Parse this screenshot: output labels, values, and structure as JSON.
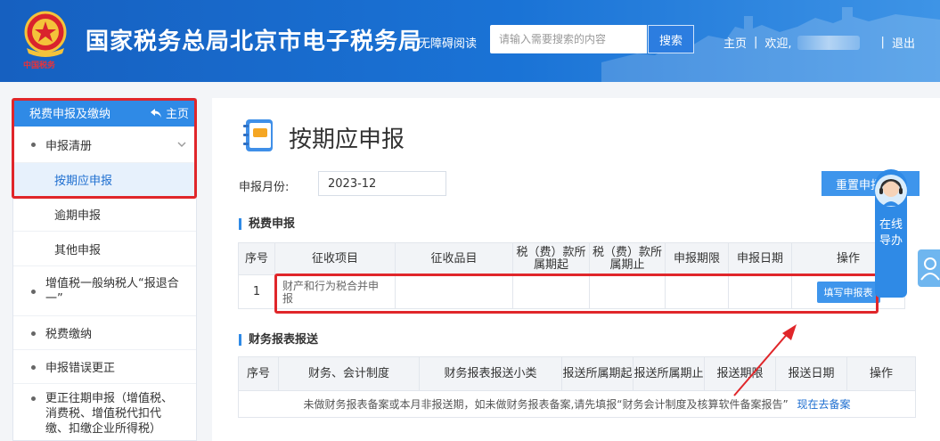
{
  "header": {
    "site_title": "国家税务总局北京市电子税务局",
    "emblem_caption": "中国税务",
    "accessibility": "无障碍阅读",
    "search_placeholder": "请输入需要搜索的内容",
    "search_button": "搜索",
    "nav_home": "主页",
    "sep": "|",
    "welcome": "欢迎,",
    "logout": "退出"
  },
  "sidebar": {
    "title": "税费申报及缴纳",
    "home": "主页",
    "items": [
      {
        "label": "申报清册"
      },
      {
        "label": "按期应申报"
      },
      {
        "label": "逾期申报"
      },
      {
        "label": "其他申报"
      },
      {
        "label": "增值税一般纳税人“报退合一”"
      },
      {
        "label": "税费缴纳"
      },
      {
        "label": "申报错误更正"
      },
      {
        "label": "更正往期申报（增值税、消费税、增值税代扣代缴、扣缴企业所得税）"
      }
    ]
  },
  "main": {
    "page_title": "按期应申报",
    "month_label": "申报月份:",
    "month_value": "2023-12",
    "reset_button": "重置申报",
    "tax_section": "税费申报",
    "tax_table": {
      "headers": [
        "序号",
        "征收项目",
        "征收品目",
        "税（费）款所属期起",
        "税（费）款所属期止",
        "申报期限",
        "申报日期",
        "操作"
      ],
      "row": {
        "index": "1",
        "item": "财产和行为税合并申报",
        "action": "填写申报表"
      }
    },
    "finance_section": "财务报表报送",
    "finance_table": {
      "headers": [
        "序号",
        "财务、会计制度",
        "财务报表报送小类",
        "报送所属期起",
        "报送所属期止",
        "报送期限",
        "报送日期",
        "操作"
      ],
      "notice": "未做财务报表备案或本月非报送期，如未做财务报表备案,请先填报“财务会计制度及核算软件备案报告”",
      "notice_link": "现在去备案"
    }
  },
  "floating": {
    "guide": "在线导办"
  }
}
